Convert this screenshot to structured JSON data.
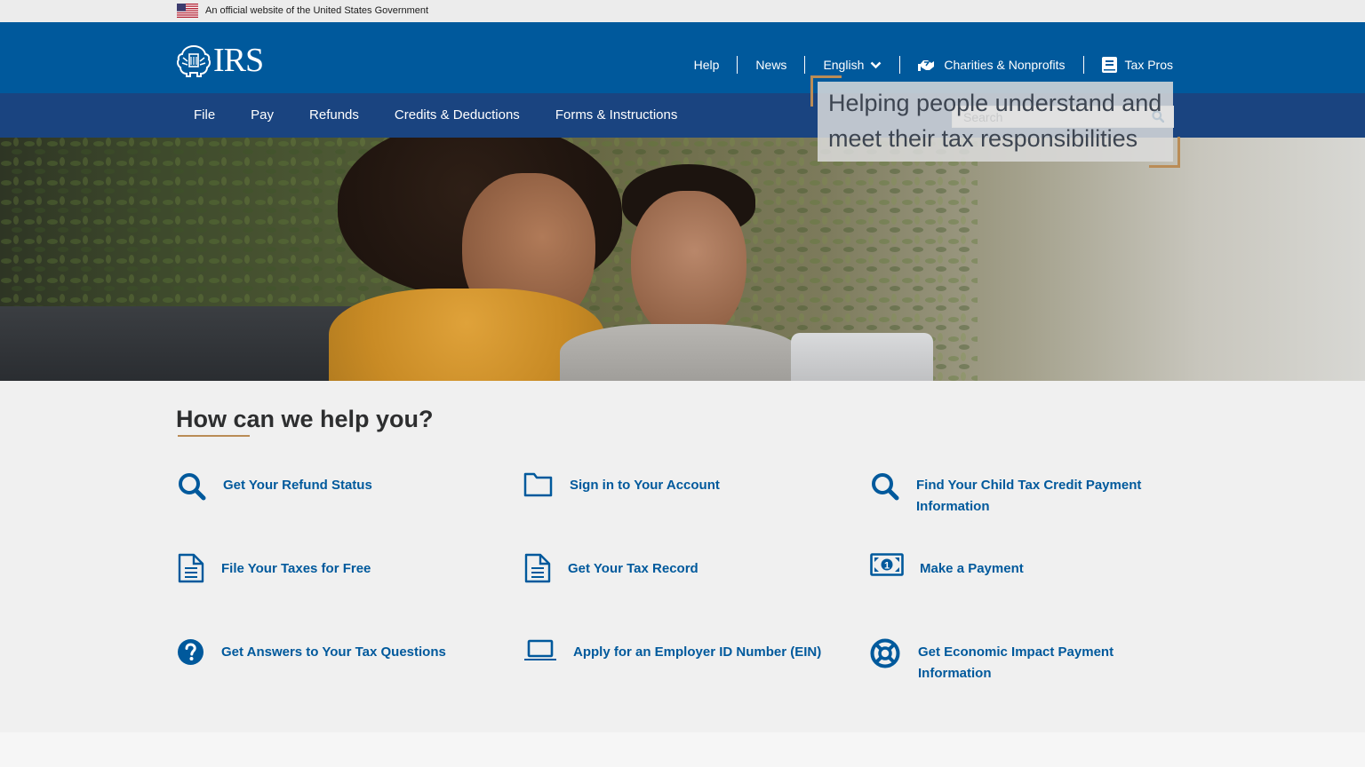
{
  "gov_banner": {
    "text": "An official website of the United States Government",
    "flag_icon": "us-flag-icon"
  },
  "header": {
    "logo_text": "IRS",
    "utility_nav": {
      "help": "Help",
      "news": "News",
      "language": "English",
      "charities": "Charities & Nonprofits",
      "tax_pros": "Tax Pros"
    }
  },
  "main_nav": {
    "items": [
      "File",
      "Pay",
      "Refunds",
      "Credits & Deductions",
      "Forms & Instructions"
    ],
    "search_placeholder": "Search"
  },
  "hero": {
    "tagline": "Helping people understand and meet their tax responsibilities"
  },
  "help": {
    "title": "How can we help you?",
    "tiles": [
      {
        "label": "Get Your Refund Status",
        "icon": "search-icon"
      },
      {
        "label": "Sign in to Your Account",
        "icon": "folder-icon"
      },
      {
        "label": "Find Your Child Tax Credit Payment Information",
        "icon": "search-icon"
      },
      {
        "label": "File Your Taxes for Free",
        "icon": "document-icon"
      },
      {
        "label": "Get Your Tax Record",
        "icon": "document-icon"
      },
      {
        "label": "Make a Payment",
        "icon": "money-icon"
      },
      {
        "label": "Get Answers to Your Tax Questions",
        "icon": "question-circle-icon"
      },
      {
        "label": "Apply for an Employer ID Number (EIN)",
        "icon": "laptop-icon"
      },
      {
        "label": "Get Economic Impact Payment Information",
        "icon": "life-ring-icon"
      }
    ]
  },
  "colors": {
    "header_blue": "#00599c",
    "nav_navy": "#1a4480",
    "accent_gold": "#ba8c56",
    "link_blue": "#00599c"
  }
}
